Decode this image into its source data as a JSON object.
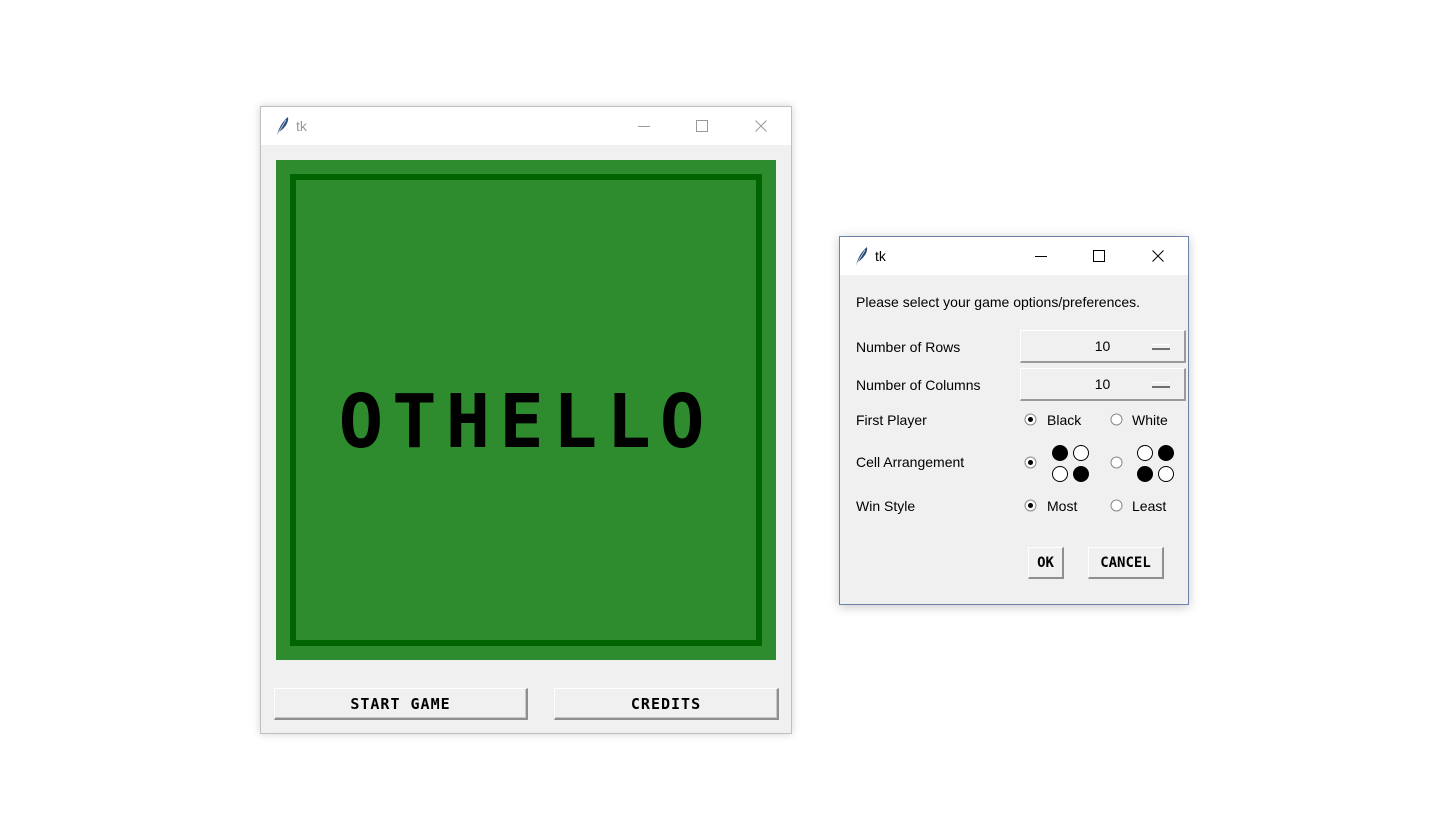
{
  "main_window": {
    "title": "tk",
    "board_title": "OTHELLO",
    "start_label": "START GAME",
    "credits_label": "CREDITS"
  },
  "options_window": {
    "title": "tk",
    "prompt": "Please select your game options/preferences.",
    "rows": {
      "label": "Number of Rows",
      "value": "10"
    },
    "columns": {
      "label": "Number of Columns",
      "value": "10"
    },
    "first_player": {
      "label": "First Player",
      "options": [
        "Black",
        "White"
      ],
      "selected": "Black"
    },
    "cell_arrangement": {
      "label": "Cell Arrangement",
      "options": [
        {
          "name": "arrangement-1",
          "cells": [
            "black",
            "white",
            "white",
            "black"
          ]
        },
        {
          "name": "arrangement-2",
          "cells": [
            "white",
            "black",
            "black",
            "white"
          ]
        }
      ],
      "selected_index": 0
    },
    "win_style": {
      "label": "Win Style",
      "options": [
        "Most",
        "Least"
      ],
      "selected": "Most"
    },
    "ok_label": "OK",
    "cancel_label": "CANCEL"
  },
  "colors": {
    "board_green": "#2e8b2e",
    "board_border": "#006400",
    "feather_icon": "#2a4d7a"
  },
  "icons": [
    "feather-icon",
    "minimize-icon",
    "maximize-icon",
    "close-icon",
    "radio-icon"
  ]
}
